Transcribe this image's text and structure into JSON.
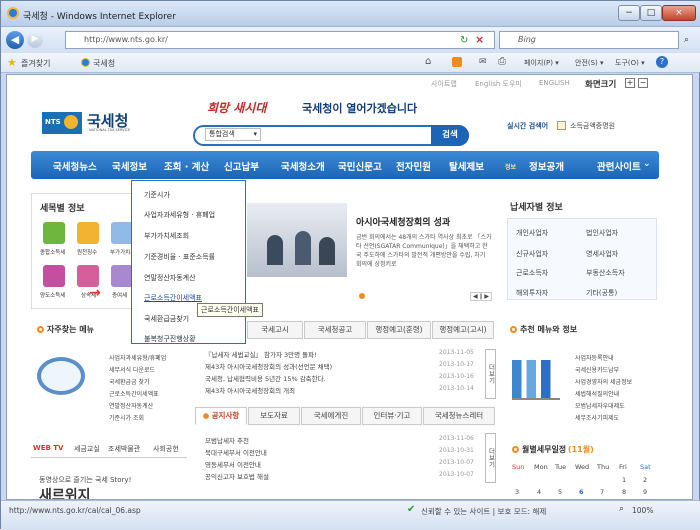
{
  "window": {
    "title": "국세청 - Windows Internet Explorer",
    "minimize": "−",
    "restore": "□",
    "close": "×"
  },
  "address": {
    "url": "http://www.nts.go.kr/",
    "search_placeholder": "Bing"
  },
  "favorites": {
    "label": "즐겨찾기",
    "tab": "국세청"
  },
  "command_bar": {
    "page": "페이지(P) ▾",
    "safety": "안전(S) ▾",
    "tools": "도구(O) ▾"
  },
  "site": {
    "top_links": [
      "사이트맵",
      "English 도우미",
      "ENGLISH"
    ],
    "zoom_label": "화면크기",
    "logo_text": "국세청",
    "logo_sub": "NATIONAL TAX SERVICE",
    "slogan_script": "희망 새시대",
    "slogan": "국세청이 열어가겠습니다",
    "search_select": "통합검색",
    "search_button": "검색",
    "realtime_label": "실시간 검색어",
    "realtime_keyword": "소득금액증명원",
    "nav": [
      "국세청뉴스",
      "국세정보",
      "조회 · 계산",
      "신고납부",
      "국세청소개",
      "국민신문고",
      "전자민원",
      "탈세제보",
      "정보공개",
      "관련사이트"
    ],
    "nav_sub_label": "정보",
    "dropdown": [
      "기준시가",
      "사업자과세유형 · 휴폐업",
      "부가가치세조회",
      "기준경비율 · 표준소득률",
      "연말정산자동계산",
      "근로소득간이세액표",
      "국세환급금찾기",
      "불복청구진행상황"
    ],
    "tooltip": "근로소득간이세액표",
    "taxinfo_title": "세목별 정보",
    "taxinfo_items": [
      "종합소득세",
      "원천징수",
      "부가가치세",
      "양도소득세",
      "상속세",
      "증여세"
    ],
    "news_title": "아시아국세청장회의 성과",
    "news_body": "금번 회의에서는 48개의 스가타 역사상 최초로 「스가타 선언(SGATAR Communique)」을 채택하고 한국 주도하에 스가타의 발전적 개편방안을 수립, 차기 회의에 상정키로",
    "news_pager": "◀ ∥ ▶",
    "taxpayer_title": "납세자별 정보",
    "taxpayer_items": [
      "개인사업자",
      "법인사업자",
      "신규사업자",
      "영세사업자",
      "근로소득자",
      "부동산소득자",
      "해외투자자",
      "기타(공통)"
    ],
    "faq_title": "자주찾는 메뉴",
    "faq_items": [
      "사업자과세유형/휴폐업",
      "세무서식 다운로드",
      "국세환급금 찾기",
      "근로소득간이세액표",
      "연말정산자동계산",
      "기준시가 조회"
    ],
    "notice_tabs_top": [
      "국세고시",
      "국세청공고",
      "행정예고(훈령)",
      "행정예고(고시)"
    ],
    "notice_list_top": [
      {
        "text": "『납세자 세법교실』 참가자 3만명 돌파!",
        "date": "2013-11-05"
      },
      {
        "text": "제43차 아시아국세청장회의 성과(선언문 채택)",
        "date": "2013-10-17"
      },
      {
        "text": "국세청, 납세협력비용 5년간 15% 감축한다.",
        "date": "2013-10-16"
      },
      {
        "text": "제43차 아시아국세청장회의 개최",
        "date": "2013-10-14"
      }
    ],
    "notice_tabs": [
      "공지사항",
      "보도자료",
      "국세에게진",
      "인터뷰·기고",
      "국세청뉴스레터"
    ],
    "notice_list": [
      {
        "text": "모범납세자 추천",
        "date": "2013-11-06"
      },
      {
        "text": "북대구세무서 이전안내",
        "date": "2013-10-31"
      },
      {
        "text": "영동세무서 이전안내",
        "date": "2013-10-07"
      },
      {
        "text": "공익신고자 보호법 해설",
        "date": "2013-10-07"
      }
    ],
    "more": "더보기",
    "recommend_title": "추천 메뉴와 정보",
    "recommend_items": [
      "사업자등록안내",
      "국세신용카드납부",
      "사업경영자의 세금정보",
      "세법해석질의안내",
      "모범납세자우대제도",
      "세무조사기피제도"
    ],
    "calendar_title": "월별세무일정",
    "calendar_month": "(11월)",
    "calendar_days": [
      "Sun",
      "Mon",
      "Tue",
      "Wed",
      "Thu",
      "Fri",
      "Sat"
    ],
    "calendar_rows": [
      [
        "",
        "",
        "",
        "",
        "",
        "1",
        "2"
      ],
      [
        "3",
        "4",
        "5",
        "6",
        "7",
        "8",
        "9"
      ]
    ],
    "webtv_tabs": [
      "WEB TV",
      "세금교실",
      "조세박물관",
      "사회공헌"
    ],
    "webtv_caption": "동영상으로 즐기는 국세 Story!",
    "webtv_big": "새르위지"
  },
  "status": {
    "url": "http://www.nts.go.kr/cal/cal_06.asp",
    "zone": "신뢰할 수 있는 사이트 | 보호 모드: 해제",
    "zoom": "100%"
  },
  "colors": {
    "nav": "#2670c4",
    "accent": "#1c64b6",
    "orange": "#f08a1c",
    "red": "#e0322b"
  }
}
